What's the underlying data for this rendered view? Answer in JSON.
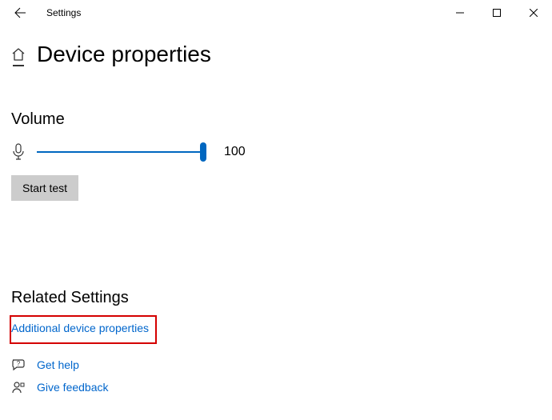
{
  "titlebar": {
    "app_name": "Settings"
  },
  "page": {
    "title": "Device properties"
  },
  "volume": {
    "heading": "Volume",
    "value": "100",
    "start_test_label": "Start test"
  },
  "related": {
    "heading": "Related Settings",
    "additional_link": "Additional device properties"
  },
  "footer": {
    "get_help": "Get help",
    "give_feedback": "Give feedback"
  }
}
